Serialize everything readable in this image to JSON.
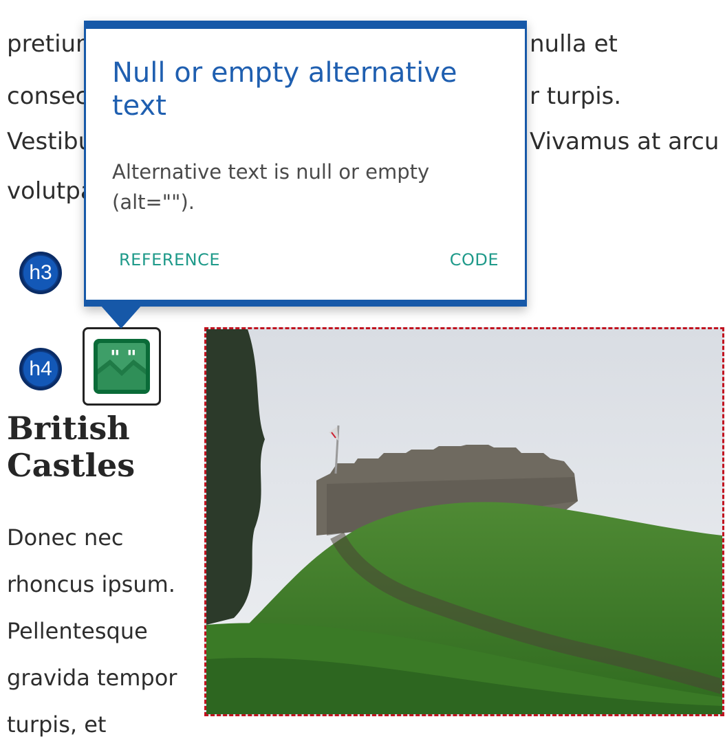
{
  "page": {
    "intro_lines": [
      "pretium",
      "consec",
      "Vestibu",
      "volutpa"
    ],
    "intro_right_lines": [
      "nulla et",
      "r turpis.",
      "Vivamus at arcu"
    ],
    "badges": {
      "h3": "h3",
      "h4": "h4"
    },
    "heading_line1": "British",
    "heading_line2": "Castles",
    "paragraph_lines": [
      "Donec nec",
      "rhoncus ipsum.",
      "Pellentesque",
      "gravida tempor",
      "turpis, et"
    ]
  },
  "tooltip": {
    "title": "Null or empty alternative text",
    "body": "Alternative text is null or empty (alt=\"\").",
    "reference_label": "REFERENCE",
    "code_label": "CODE"
  },
  "colors": {
    "tooltip_accent": "#1658a8",
    "badge_blue": "#1358b7",
    "alt_icon_green": "#0a6b38",
    "image_outline_red": "#c1121f",
    "link_teal": "#1f9a8a"
  },
  "icons": {
    "alt_issue": "image-quote-icon"
  }
}
